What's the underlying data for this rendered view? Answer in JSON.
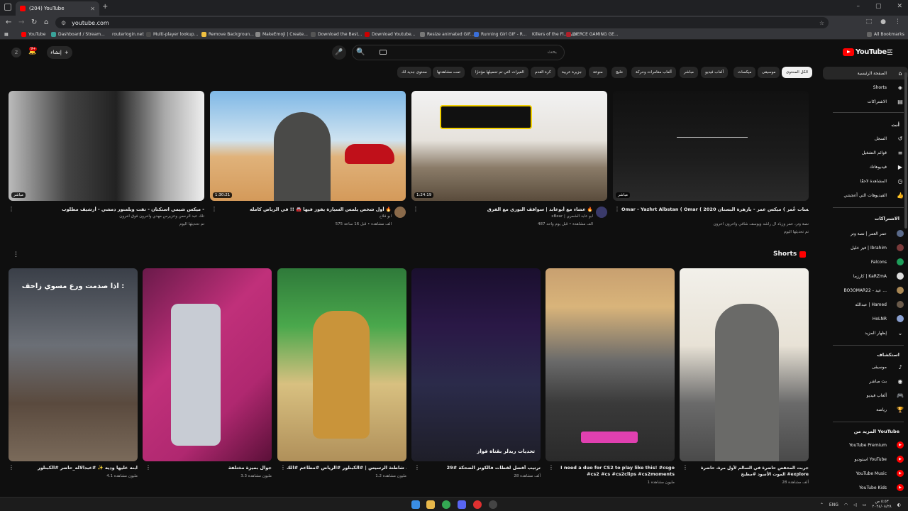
{
  "browser": {
    "tab_title": "(204) YouTube",
    "url": "youtube.com",
    "bookmarks": [
      "YouTube",
      "Dashboard / Stream...",
      "routerlogin.net",
      "Multi-player lookup...",
      "Remove Backgroun...",
      "MakeEmoji | Create...",
      "Download the Best...",
      "Download Youtube...",
      "Resize animated GIF...",
      "Running Girl GIF - R...",
      "Killers of the Fl... فيلم",
      "FIERCE GAMING GE..."
    ],
    "all_bookmarks": "All Bookmarks"
  },
  "header": {
    "search_placeholder": "بحث",
    "create_label": "إنشاء",
    "notif_count": "9+",
    "logo_text": "YouTube",
    "logo_region": "SA"
  },
  "chips": [
    "الكل المحتوى",
    "موسيقى",
    "ميكسات",
    "ألعاب فيديو",
    "مباشر",
    "ألعاب مغامرات وحركة",
    "خليج",
    "منوعة",
    "جزيرة عربية",
    "كرة القدم",
    "الفيرات التي تم تحميلها مؤخرًا",
    "تمت مشاهدتها",
    "محتوى جديد لك"
  ],
  "colors": {
    "accent": "#ff0000",
    "bg": "#0f0f0f"
  },
  "videos": [
    {
      "title": "ميكس شيمي استكتان - تقت ويلمنور دمشي - أرشيف مطلوب -",
      "channel": "تلك عبد الرحمن وعزيرس مهدي وآخرون فوق آخرون",
      "meta": "تم تحديثها اليوم",
      "duration": "مباشر"
    },
    {
      "title": "أول شخص يلمس السيارة يفوز فيها 🚘 !! في الرياض كامله 🔥",
      "channel": "أبو فلاح",
      "meta": "575 ألف مشاهدة • قبل 16 ساعة",
      "duration": "1:30:21"
    },
    {
      "title": "عشاء مع أبوعابد | سواقف البوري مع الفرق 🔥",
      "channel": "xBear | أبو عابد الشمري",
      "meta": "487 ألف مشاهدة • قبل يوم واحد",
      "duration": "1:24:19"
    },
    {
      "title": "Omar - Yazhrt Albstan ( Omar ( 2020 ميكس عمر - يازهرة البستان ( جلسات عُمر Album 2020 )",
      "channel": "نصة وتر، عمر وزياد آل راشد ويوسف شافي وآخرون آخرون",
      "meta": "تم تحديثها اليوم",
      "duration": "مباشر"
    }
  ],
  "shorts_title": "Shorts",
  "shorts": [
    {
      "title": "ابنه عليها وديه ✨ #عبدالاله_حاضر #الكبنلور",
      "views": "4.1 مليون مشاهدة",
      "overlay": "اذا صدمت ورع مسوي زاحف :"
    },
    {
      "title": "جوال بميزة مختلفة",
      "views": "3.3 مليون مشاهدة",
      "overlay": ""
    },
    {
      "title": "برياية شاطنة الرسيس | #الكبنلور #الرياض #مطاعم #الك",
      "views": "1.2 مليون مشاهدة",
      "overlay": ""
    },
    {
      "title": "ترتيب أفضل لقطات فالكونز الضحكة #29",
      "views": "28 ألف مشاهدة",
      "overlay": "تحديات ريدلر بقناة فواز"
    },
    {
      "title": "I need a duo for CS2 to play like this! #csgo #cs2 #cs #cs2clips #cs2moments",
      "views": "1 مليون مشاهدة",
      "overlay": ""
    },
    {
      "title": "جربت المحفص حاضرة في السالم لأول مرة، حاضرة الموت الأسود #مطبخ #explore",
      "views": "28 ألف مشاهدة",
      "overlay": ""
    }
  ],
  "sidebar": {
    "main": [
      "الصفحة الرئيسية",
      "Shorts",
      "الاشتراكات"
    ],
    "you_header": "أنت",
    "you": [
      "السجل",
      "قوائم التشغيل",
      "فيديوهاتك",
      "المشاهدة لاحقًا",
      "الفيديوهات التي أعجبتني"
    ],
    "subs_header": "الاشتراكات",
    "subs": [
      "عمر العمر | نصة وتر",
      "فيز خليل | Ibrahim",
      "Falcons",
      "كارزما | KaRZmA",
      "BO3OMAR22 - عيد ...",
      "عبدالله | Hamed",
      "HoLNR",
      "إظهار المزيد"
    ],
    "explore_header": "استكشاف",
    "explore": [
      "موسيقى",
      "بث مباشر",
      "ألعاب فيديو",
      "رياضة"
    ],
    "more_header": "المزيد من YouTube",
    "more": [
      "YouTube Premium",
      "استوديو YouTube",
      "YouTube Music",
      "YouTube Kids"
    ]
  },
  "taskbar": {
    "lang": "ENG",
    "time": "٥:٥٣ ص",
    "date": "٢٠٢٤/٠٨/٢٨"
  }
}
